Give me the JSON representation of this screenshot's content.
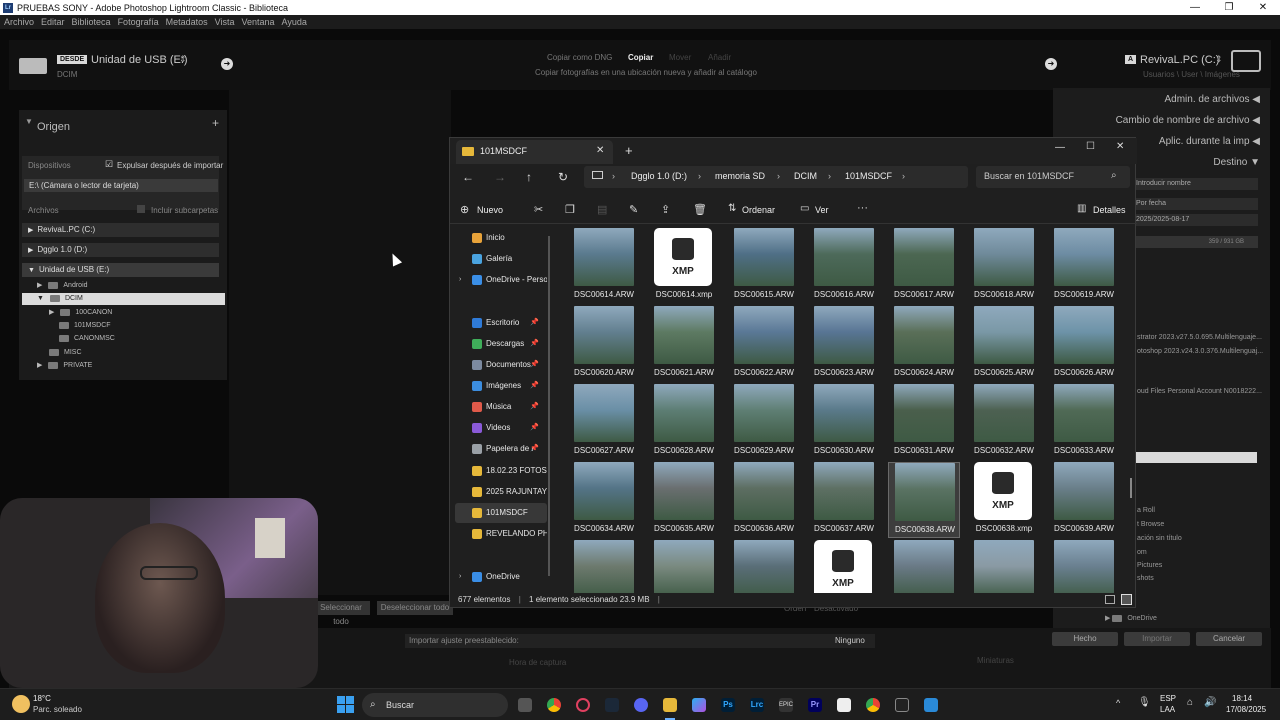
{
  "window": {
    "title": "PRUEBAS SONY - Adobe Photoshop Lightroom Classic - Biblioteca",
    "app_badge": "Lr"
  },
  "menu": [
    "Archivo",
    "Editar",
    "Biblioteca",
    "Fotografía",
    "Metadatos",
    "Vista",
    "Ventana",
    "Ayuda"
  ],
  "lr_top": {
    "source_tag": "DESDE",
    "source_name": "Unidad de USB (E:)",
    "source_path": "DCIM",
    "modes": [
      "Copiar como DNG",
      "Copiar",
      "Mover",
      "Añadir"
    ],
    "mode_desc": "Copiar fotografías en una ubicación nueva y añadir al catálogo",
    "dest_tag": "A",
    "dest_name": "RevivaL.PC (C:)",
    "dest_path": "Usuarios \\ User \\ Imágenes"
  },
  "left_panel": {
    "title": "Origen",
    "add": "+",
    "devices_label": "Dispositivos",
    "eject_label": "Expulsar después de importar",
    "device_field": "E:\\ (Cámara o lector de tarjeta)",
    "files_label": "Archivos",
    "subfolders_label": "Incluir subcarpetas",
    "drives": [
      "RevivaL.PC (C:)",
      "Dgglo 1.0 (D:)",
      "Unidad de USB (E:)"
    ],
    "folders": [
      "Android",
      "DCIM",
      "100CANON",
      "101MSDCF",
      "CANONMSC",
      "MISC",
      "PRIVATE"
    ]
  },
  "right_panel": {
    "headers": [
      "Admin. de archivos",
      "Cambio de nombre de archivo",
      "Aplic. durante la imp",
      "Destino"
    ],
    "fields": [
      "Introducir nombre",
      "Por fecha",
      "2025/2025-08-17"
    ],
    "space": "359 / 931 GB",
    "list": [
      "strator 2023.v27.5.0.695.Multilenguaje...",
      "otoshop 2023.v24.3.0.376.Multilenguaj...",
      "oud Files Personal Account N0018222..."
    ],
    "list2": [
      "a Roll",
      "t Browse",
      "ación sin título",
      "om",
      "Pictures",
      "shots"
    ],
    "onedrive": "OneDrive"
  },
  "lr_bottom": {
    "select_all": "Seleccionar todo",
    "deselect_all": "Deseleccionar todo",
    "order_label": "Orden",
    "order_value": "Desactivado",
    "preset_label": "Importar ajuste preestablecido:",
    "preset_value": "Ninguno",
    "capture_label": "Hora de captura",
    "thumbs_label": "Miniaturas",
    "done": "Hecho",
    "import": "Importar",
    "cancel": "Cancelar"
  },
  "explorer": {
    "tab_title": "101MSDCF",
    "breadcrumb": [
      "Dgglo 1.0 (D:)",
      "memoria SD",
      "DCIM",
      "101MSDCF"
    ],
    "search_placeholder": "Buscar en 101MSDCF",
    "commands": {
      "new": "Nuevo",
      "sort": "Ordenar",
      "view": "Ver",
      "more": "···",
      "details": "Detalles"
    },
    "nav": [
      {
        "label": "Inicio",
        "color": "#e8a33a",
        "pin": false
      },
      {
        "label": "Galería",
        "color": "#4aa3df",
        "pin": false
      },
      {
        "label": "OneDrive - Perso",
        "color": "#3a8ee6",
        "pin": false
      },
      {
        "label": "Escritorio",
        "color": "#2f7bd8",
        "pin": true
      },
      {
        "label": "Descargas",
        "color": "#3fae5a",
        "pin": true
      },
      {
        "label": "Documentos",
        "color": "#7c8aa0",
        "pin": true
      },
      {
        "label": "Imágenes",
        "color": "#3c8ddf",
        "pin": true
      },
      {
        "label": "Música",
        "color": "#e05a4a",
        "pin": true
      },
      {
        "label": "Videos",
        "color": "#8a5ad8",
        "pin": true
      },
      {
        "label": "Papelera de r",
        "color": "#9aa0a6",
        "pin": true
      },
      {
        "label": "18.02.23 FOTOS",
        "color": "#e6b83a",
        "pin": false
      },
      {
        "label": "2025 RAJUNTAY",
        "color": "#e6b83a",
        "pin": false
      },
      {
        "label": "101MSDCF",
        "color": "#e6b83a",
        "pin": false
      },
      {
        "label": "REVELANDO PH",
        "color": "#e6b83a",
        "pin": false
      },
      {
        "label": "OneDrive",
        "color": "#3a8ee6",
        "pin": false
      }
    ],
    "files": [
      {
        "name": "DSC00614.ARW",
        "kind": "photo",
        "tone": "#5a7a8e"
      },
      {
        "name": "DSC00614.xmp",
        "kind": "xmp"
      },
      {
        "name": "DSC00615.ARW",
        "kind": "photo",
        "tone": "#4f6f86"
      },
      {
        "name": "DSC00616.ARW",
        "kind": "photo",
        "tone": "#4d6a5a"
      },
      {
        "name": "DSC00617.ARW",
        "kind": "photo",
        "tone": "#4c6752"
      },
      {
        "name": "DSC00618.ARW",
        "kind": "photo",
        "tone": "#6f8a9a"
      },
      {
        "name": "DSC00619.ARW",
        "kind": "photo",
        "tone": "#6d8ca3"
      },
      {
        "name": "DSC00620.ARW",
        "kind": "photo",
        "tone": "#627f8f"
      },
      {
        "name": "DSC00621.ARW",
        "kind": "photo",
        "tone": "#5d7a62"
      },
      {
        "name": "DSC00622.ARW",
        "kind": "photo",
        "tone": "#5a7896"
      },
      {
        "name": "DSC00623.ARW",
        "kind": "photo",
        "tone": "#587594"
      },
      {
        "name": "DSC00624.ARW",
        "kind": "photo",
        "tone": "#5a6f58"
      },
      {
        "name": "DSC00625.ARW",
        "kind": "photo",
        "tone": "#7a98a6"
      },
      {
        "name": "DSC00626.ARW",
        "kind": "photo",
        "tone": "#6d93a8"
      },
      {
        "name": "DSC00627.ARW",
        "kind": "photo",
        "tone": "#6a8fa6"
      },
      {
        "name": "DSC00628.ARW",
        "kind": "photo",
        "tone": "#5d7e74"
      },
      {
        "name": "DSC00629.ARW",
        "kind": "photo",
        "tone": "#5f7f74"
      },
      {
        "name": "DSC00630.ARW",
        "kind": "photo",
        "tone": "#5a7a8a"
      },
      {
        "name": "DSC00631.ARW",
        "kind": "photo",
        "tone": "#4a5f4c"
      },
      {
        "name": "DSC00632.ARW",
        "kind": "photo",
        "tone": "#4d6152"
      },
      {
        "name": "DSC00633.ARW",
        "kind": "photo",
        "tone": "#506a56"
      },
      {
        "name": "DSC00634.ARW",
        "kind": "photo",
        "tone": "#547487"
      },
      {
        "name": "DSC00635.ARW",
        "kind": "photo",
        "tone": "#6a6f70"
      },
      {
        "name": "DSC00636.ARW",
        "kind": "photo",
        "tone": "#5d6e62"
      },
      {
        "name": "DSC00637.ARW",
        "kind": "photo",
        "tone": "#5e7064"
      },
      {
        "name": "DSC00638.ARW",
        "kind": "photo",
        "tone": "#5a7363",
        "selected": true
      },
      {
        "name": "DSC00638.xmp",
        "kind": "xmp"
      },
      {
        "name": "DSC00639.ARW",
        "kind": "photo",
        "tone": "#6a7f8a"
      },
      {
        "name": "",
        "kind": "photo",
        "tone": "#6d7a6e"
      },
      {
        "name": "",
        "kind": "photo",
        "tone": "#7a8a80"
      },
      {
        "name": "",
        "kind": "photo",
        "tone": "#5a6e78"
      },
      {
        "name": "",
        "kind": "xmp"
      },
      {
        "name": "",
        "kind": "photo",
        "tone": "#6a7a86"
      },
      {
        "name": "",
        "kind": "photo",
        "tone": "#8a9aa4"
      },
      {
        "name": "",
        "kind": "photo",
        "tone": "#6a8090"
      }
    ],
    "status_count": "677 elementos",
    "status_selected": "1 elemento seleccionado  23.9 MB"
  },
  "taskbar": {
    "weather_temp": "18°C",
    "weather_desc": "Parc. soleado",
    "search": "Buscar",
    "lang": "ESP",
    "lang2": "LAA",
    "time": "18:14",
    "date": "17/08/2025"
  },
  "colors": {
    "accent": "#0a64c8",
    "folder": "#e6b83a"
  }
}
